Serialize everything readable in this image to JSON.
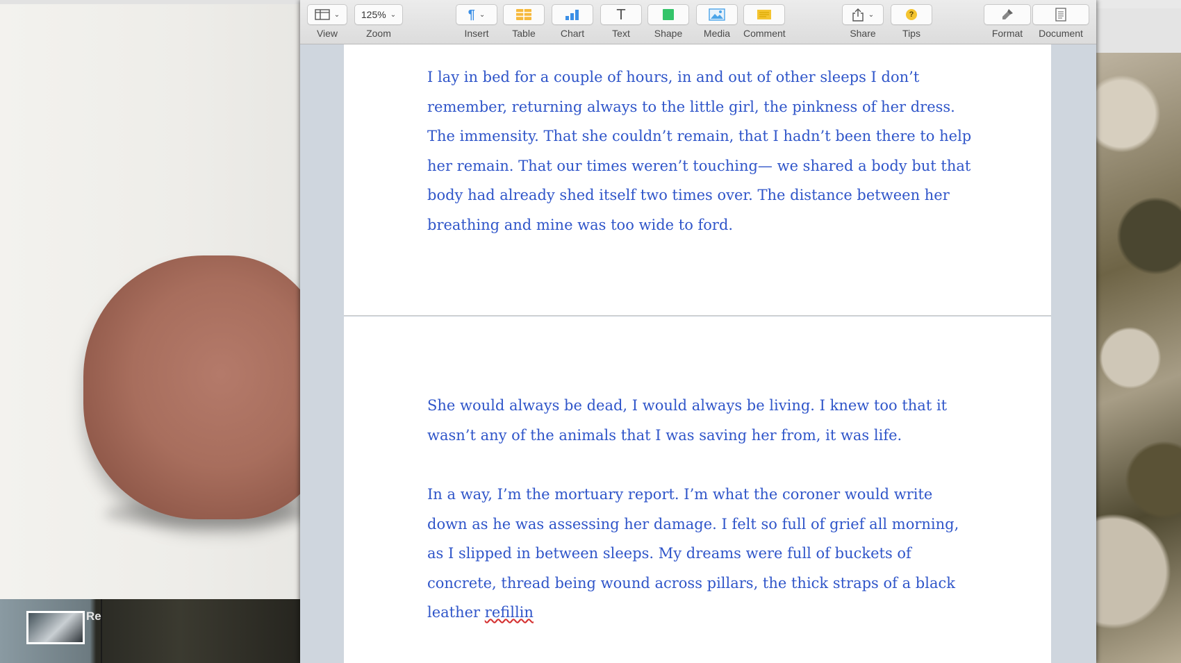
{
  "background_left": {
    "dock_label": "Re"
  },
  "toolbar": {
    "view": {
      "label": "View",
      "icon": "sidebar-view-icon"
    },
    "zoom": {
      "label": "Zoom",
      "value": "125%"
    },
    "insert": {
      "label": "Insert",
      "icon": "pilcrow-icon"
    },
    "table": {
      "label": "Table",
      "icon": "table-icon",
      "color": "#f6b93b"
    },
    "chart": {
      "label": "Chart",
      "icon": "chart-icon",
      "color": "#3b8fe6"
    },
    "text": {
      "label": "Text",
      "icon": "text-icon"
    },
    "shape": {
      "label": "Shape",
      "icon": "shape-icon",
      "color": "#34c46a"
    },
    "media": {
      "label": "Media",
      "icon": "media-icon",
      "color": "#4aa3e8"
    },
    "comment": {
      "label": "Comment",
      "icon": "comment-icon",
      "color": "#f4c430"
    },
    "share": {
      "label": "Share",
      "icon": "share-icon"
    },
    "tips": {
      "label": "Tips",
      "icon": "tips-icon",
      "glyph": "?",
      "color": "#f4c430"
    },
    "format": {
      "label": "Format",
      "icon": "format-brush-icon"
    },
    "document": {
      "label": "Document",
      "icon": "document-icon"
    }
  },
  "document": {
    "text_color": "#2f55c9",
    "page1": {
      "paragraph1": "I lay in bed for a couple of hours, in and out of other sleeps I don’t remember, returning always to the little girl, the pinkness of her dress. The immensity. That she couldn’t remain, that I hadn’t been there to help her remain. That our times weren’t touching— we shared a body but that body had already shed itself two times over. The distance between her breathing and mine was too wide to ford."
    },
    "page2": {
      "paragraph1": "She would always be dead, I would always be living. I knew too that it wasn’t any of the animals that I was saving her from, it was life.",
      "paragraph2_text": "In a way, I’m the mortuary report. I’m what the coroner would write down as he was assessing her damage. I felt so full of grief all morning, as I slipped in between sleeps. My dreams were full of buckets of concrete, thread being wound across pillars, the thick straps of a black leather ",
      "paragraph2_misspelled": "refillin"
    }
  }
}
